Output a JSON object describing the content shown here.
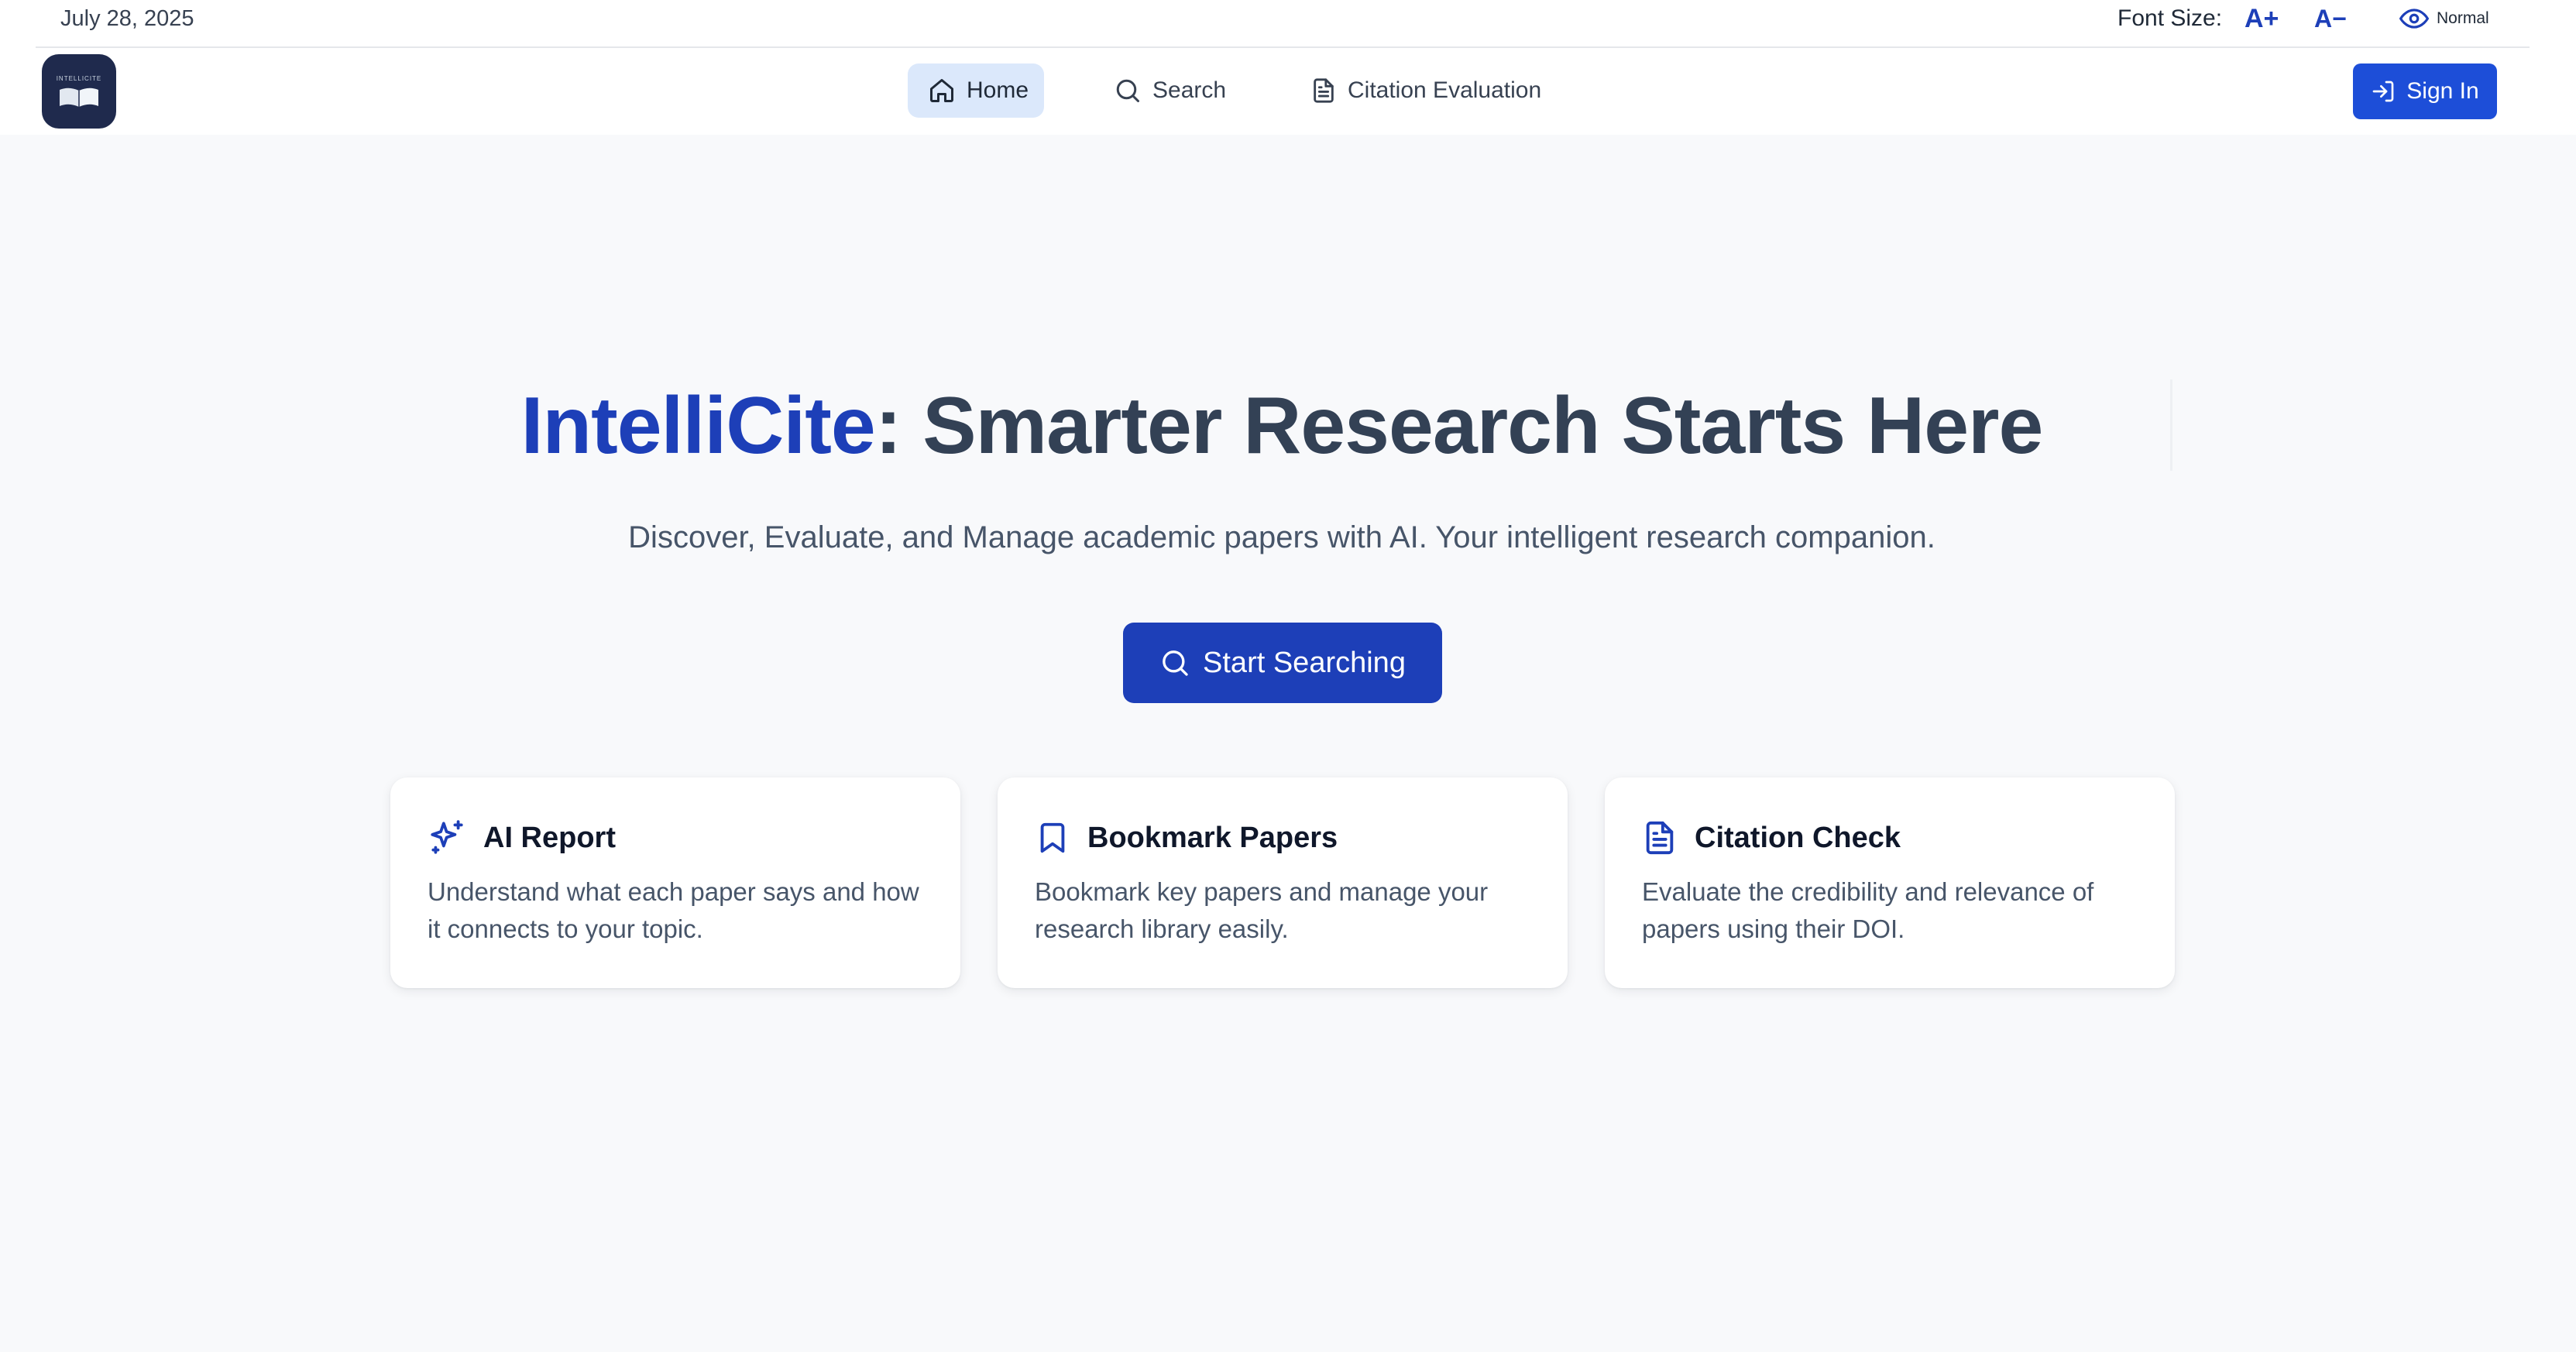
{
  "topbar": {
    "date": "July 28, 2025",
    "font_size_label": "Font Size:",
    "increase_label": "A+",
    "decrease_label": "A−",
    "mode_label": "Normal"
  },
  "nav": {
    "logo_text": "INTELLICITE",
    "items": [
      {
        "label": "Home",
        "icon": "home-icon",
        "active": true
      },
      {
        "label": "Search",
        "icon": "search-icon",
        "active": false
      },
      {
        "label": "Citation Evaluation",
        "icon": "document-icon",
        "active": false
      }
    ],
    "signin_label": "Sign In"
  },
  "hero": {
    "brand": "IntelliCite",
    "title_rest": ": Smarter Research Starts Here",
    "subtitle": "Discover, Evaluate, and Manage academic papers with AI. Your intelligent research companion.",
    "cta_label": "Start Searching"
  },
  "features": [
    {
      "title": "AI Report",
      "icon": "sparkles-icon",
      "description": "Understand what each paper says and how it connects to your topic."
    },
    {
      "title": "Bookmark Papers",
      "icon": "bookmark-icon",
      "description": "Bookmark key papers and manage your research library easily."
    },
    {
      "title": "Citation Check",
      "icon": "document-icon",
      "description": "Evaluate the credibility and relevance of papers using their DOI."
    }
  ],
  "colors": {
    "brand": "#1d3fb8",
    "primary_button": "#1d4ed8",
    "active_nav_bg": "#dbe8fb",
    "background": "#f8f9fb"
  }
}
